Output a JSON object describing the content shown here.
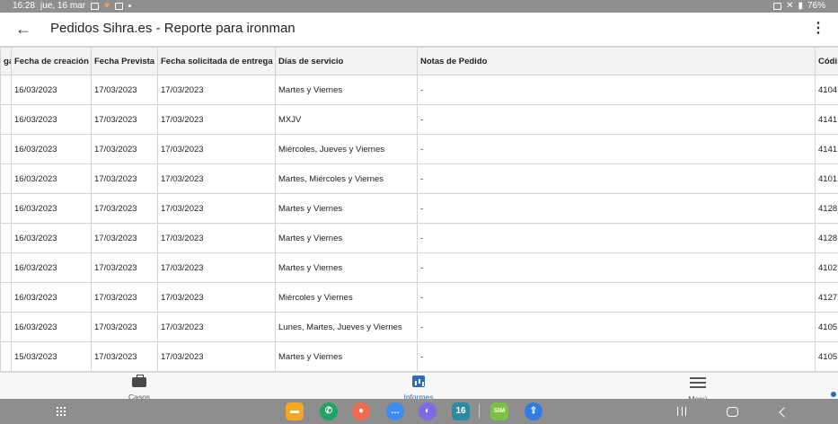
{
  "status_bar": {
    "time": "16:28",
    "date": "jue, 16 mar",
    "battery": "76%"
  },
  "header": {
    "title": "Pedidos Sihra.es - Reporte para ironman",
    "back_icon": "arrow-left-icon",
    "more_icon": "more-vert-icon"
  },
  "table": {
    "columns": [
      "ga",
      "Fecha de creación",
      "Fecha Prevista",
      "Fecha solicitada de entrega",
      "Días de servicio",
      "Notas de Pedido",
      "Códi"
    ],
    "rows": [
      [
        "",
        "16/03/2023",
        "17/03/2023",
        "17/03/2023",
        "Martes y Viernes",
        "-",
        "4104"
      ],
      [
        "",
        "16/03/2023",
        "17/03/2023",
        "17/03/2023",
        "MXJV",
        "-",
        "4141"
      ],
      [
        "",
        "16/03/2023",
        "17/03/2023",
        "17/03/2023",
        "Miércoles, Jueves y Viernes",
        "-",
        "4141"
      ],
      [
        "",
        "16/03/2023",
        "17/03/2023",
        "17/03/2023",
        "Martes, Miércoles y Viernes",
        "-",
        "4101"
      ],
      [
        "",
        "16/03/2023",
        "17/03/2023",
        "17/03/2023",
        "Martes y Viernes",
        "-",
        "4128"
      ],
      [
        "",
        "16/03/2023",
        "17/03/2023",
        "17/03/2023",
        "Martes y Viernes",
        "-",
        "4128"
      ],
      [
        "",
        "16/03/2023",
        "17/03/2023",
        "17/03/2023",
        "Martes y Viernes",
        "-",
        "4102"
      ],
      [
        "",
        "16/03/2023",
        "17/03/2023",
        "17/03/2023",
        "Miércoles y Viernes",
        "-",
        "4127"
      ],
      [
        "",
        "16/03/2023",
        "17/03/2023",
        "17/03/2023",
        "Lunes, Martes, Jueves y Viernes",
        "-",
        "4105"
      ],
      [
        "",
        "15/03/2023",
        "17/03/2023",
        "17/03/2023",
        "Martes y Viernes",
        "-",
        "4105"
      ]
    ]
  },
  "bottom_nav": {
    "items": [
      {
        "label": "Casos",
        "icon": "briefcase-icon",
        "active": false
      },
      {
        "label": "Informes",
        "icon": "report-icon",
        "active": true
      },
      {
        "label": "Menú",
        "icon": "menu-icon",
        "active": false
      }
    ],
    "active_color": "#2c6db6"
  },
  "dock": {
    "apps": [
      {
        "name": "files",
        "icon": "folder-icon",
        "color": "#f5a623"
      },
      {
        "name": "phone",
        "icon": "phone-icon",
        "color": "#1fa463"
      },
      {
        "name": "contacts",
        "icon": "contacts-icon",
        "color": "#f26b4f"
      },
      {
        "name": "messages",
        "icon": "messages-icon",
        "color": "#3d8ef0"
      },
      {
        "name": "internet",
        "icon": "internet-icon",
        "color": "#7d6be6"
      },
      {
        "name": "calendar",
        "icon": "calendar-icon",
        "color": "#2b8aa3",
        "text": "16"
      },
      {
        "name": "sim-app",
        "icon": "sim-app-icon",
        "color": "#7cc142",
        "text": "SIM"
      },
      {
        "name": "share-app",
        "icon": "share-app-icon",
        "color": "#2f7de1"
      }
    ]
  }
}
